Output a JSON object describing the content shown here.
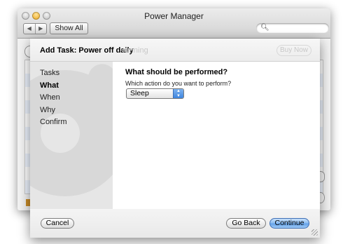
{
  "window": {
    "title": "Power Manager",
    "nav_back": "◀",
    "nav_forward": "▶",
    "show_all_label": "Show All",
    "search_placeholder": "",
    "search_icon": "magnifier-icon"
  },
  "background": {
    "faded_header_text": "running",
    "faded_button_label": "Buy Now"
  },
  "sheet": {
    "title": "Add Task: Power off daily",
    "steps": [
      "Tasks",
      "What",
      "When",
      "Why",
      "Confirm"
    ],
    "active_step": "What",
    "question": "What should be performed?",
    "subquestion": "Which action do you want to perform?",
    "action_value": "Sleep",
    "buttons": {
      "cancel": "Cancel",
      "go_back": "Go Back",
      "continue": "Continue"
    }
  },
  "colors": {
    "default_button": "#64a2ea",
    "popup_arrow": "#3d84de"
  }
}
